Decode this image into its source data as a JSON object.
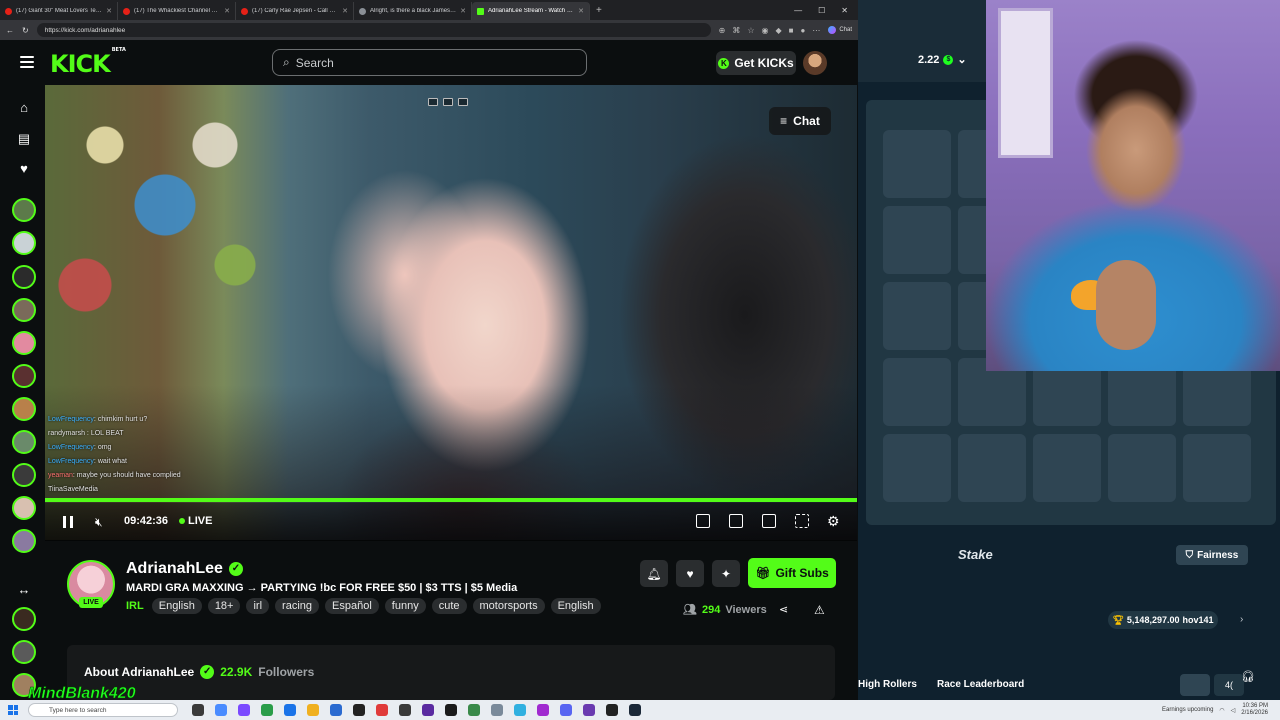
{
  "browser": {
    "tabs": [
      {
        "title": "(17) Giant 30\" Meat Lovers Team F"
      },
      {
        "title": "(17) The Whackiest Channel on Yo"
      },
      {
        "title": "(17) Carly Rae Jepsen - Call Me M"
      },
      {
        "title": "Alright, is there a black James Bon"
      },
      {
        "title": "AdrianahLee Stream - Watch Live",
        "active": true
      }
    ],
    "new_tab": "+",
    "url": "https://kick.com/adrianahlee",
    "copilot_label": "Chat"
  },
  "kick": {
    "logo": "KICK",
    "logo_badge": "BETA",
    "search_placeholder": "Search",
    "get_kicks_label": "Get KICKs",
    "chat_button_label": "Chat",
    "player": {
      "elapsed": "09:42:36",
      "live_label": "LIVE",
      "progress_fraction": 1.0
    },
    "overlay_chat": [
      {
        "user": "LowFrequency",
        "msg": "chimkim hurt u?"
      },
      {
        "user": "randymarsh",
        "msg": "LOL BEAT"
      },
      {
        "user": "LowFrequency",
        "msg": "omg"
      },
      {
        "user": "LowFrequency",
        "msg": "wait what"
      },
      {
        "user": "yeaman",
        "msg": "maybe you should have complied"
      },
      {
        "user": "TiinaSaveMedia",
        "msg": ""
      }
    ],
    "channel": {
      "name": "AdrianahLee",
      "live_badge": "LIVE",
      "stream_title": "MARDI GRA MAXXING → PARTYING !bc FOR FREE $50 | $3 TTS | $5 Media",
      "category": "IRL",
      "tags": [
        "English",
        "18+",
        "irl",
        "racing",
        "Español",
        "funny",
        "cute",
        "motorsports",
        "English"
      ],
      "gift_subs_label": "Gift Subs",
      "viewers_count": "294",
      "viewers_label": "Viewers",
      "about_title": "About AdrianahLee",
      "followers_count": "22.9K",
      "followers_label": "Followers"
    }
  },
  "stake": {
    "balance": "2.22",
    "coin_symbol": "$",
    "logo": "Stake",
    "fairness_label": "Fairness",
    "race_value": "5,148,297.00",
    "race_user": "hov141",
    "tab_high_rollers": "High Rollers",
    "tab_race_leaderboard": "Race Leaderboard",
    "btn_small": "4("
  },
  "overlay_name": "MindBlank420",
  "taskbar": {
    "search_placeholder": "Type here to search",
    "tray_note": "Earnings upcoming",
    "time": "10:36 PM",
    "date": "2/16/2026"
  },
  "colors": {
    "kick_green": "#53fc18",
    "kick_bg": "#0b0e0f",
    "stake_bg": "#0f212e",
    "stake_tile": "#2f4553"
  }
}
